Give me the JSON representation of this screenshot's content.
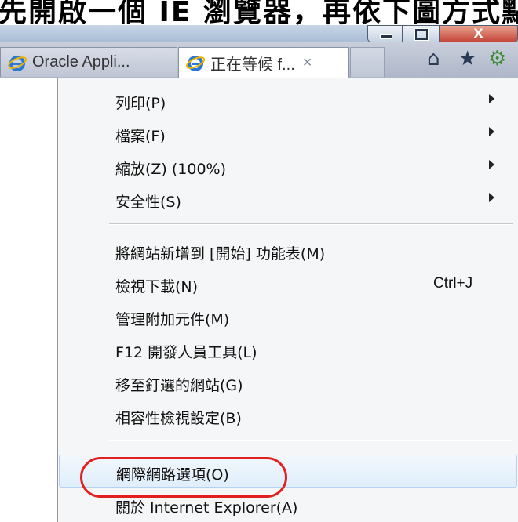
{
  "caption": {
    "text": "先開啟一個 IE 瀏覽器，再依下圖方式點選：工具 > 網際網路選項"
  },
  "window_controls": {
    "minimize": "minimize",
    "maximize": "maximize",
    "close": "X"
  },
  "tabs": [
    {
      "label": "Oracle Appli...",
      "icon": "ie-icon",
      "active": false
    },
    {
      "label": "正在等候 f...",
      "icon": "ie-icon",
      "active": true,
      "close": "×"
    }
  ],
  "toolbar": {
    "home_icon": "⌂",
    "favorites_icon": "★",
    "tools_icon": "⚙",
    "accent": "#3a8a2f"
  },
  "menu": {
    "items": [
      {
        "label": "列印(P)",
        "submenu": true
      },
      {
        "label": "檔案(F)",
        "submenu": true
      },
      {
        "label": "縮放(Z) (100%)",
        "submenu": true
      },
      {
        "label": "安全性(S)",
        "submenu": true
      },
      {
        "label": "將網站新增到 [開始] 功能表(M)",
        "submenu": false
      },
      {
        "label": "檢視下載(N)",
        "shortcut": "Ctrl+J"
      },
      {
        "label": "管理附加元件(M)"
      },
      {
        "label": "F12 開發人員工具(L)"
      },
      {
        "label": "移至釘選的網站(G)"
      },
      {
        "label": "相容性檢視設定(B)"
      },
      {
        "label": "網際網路選項(O)",
        "highlighted": true
      },
      {
        "label": "關於 Internet Explorer(A)"
      }
    ],
    "highlight_color": "#e2201f"
  }
}
